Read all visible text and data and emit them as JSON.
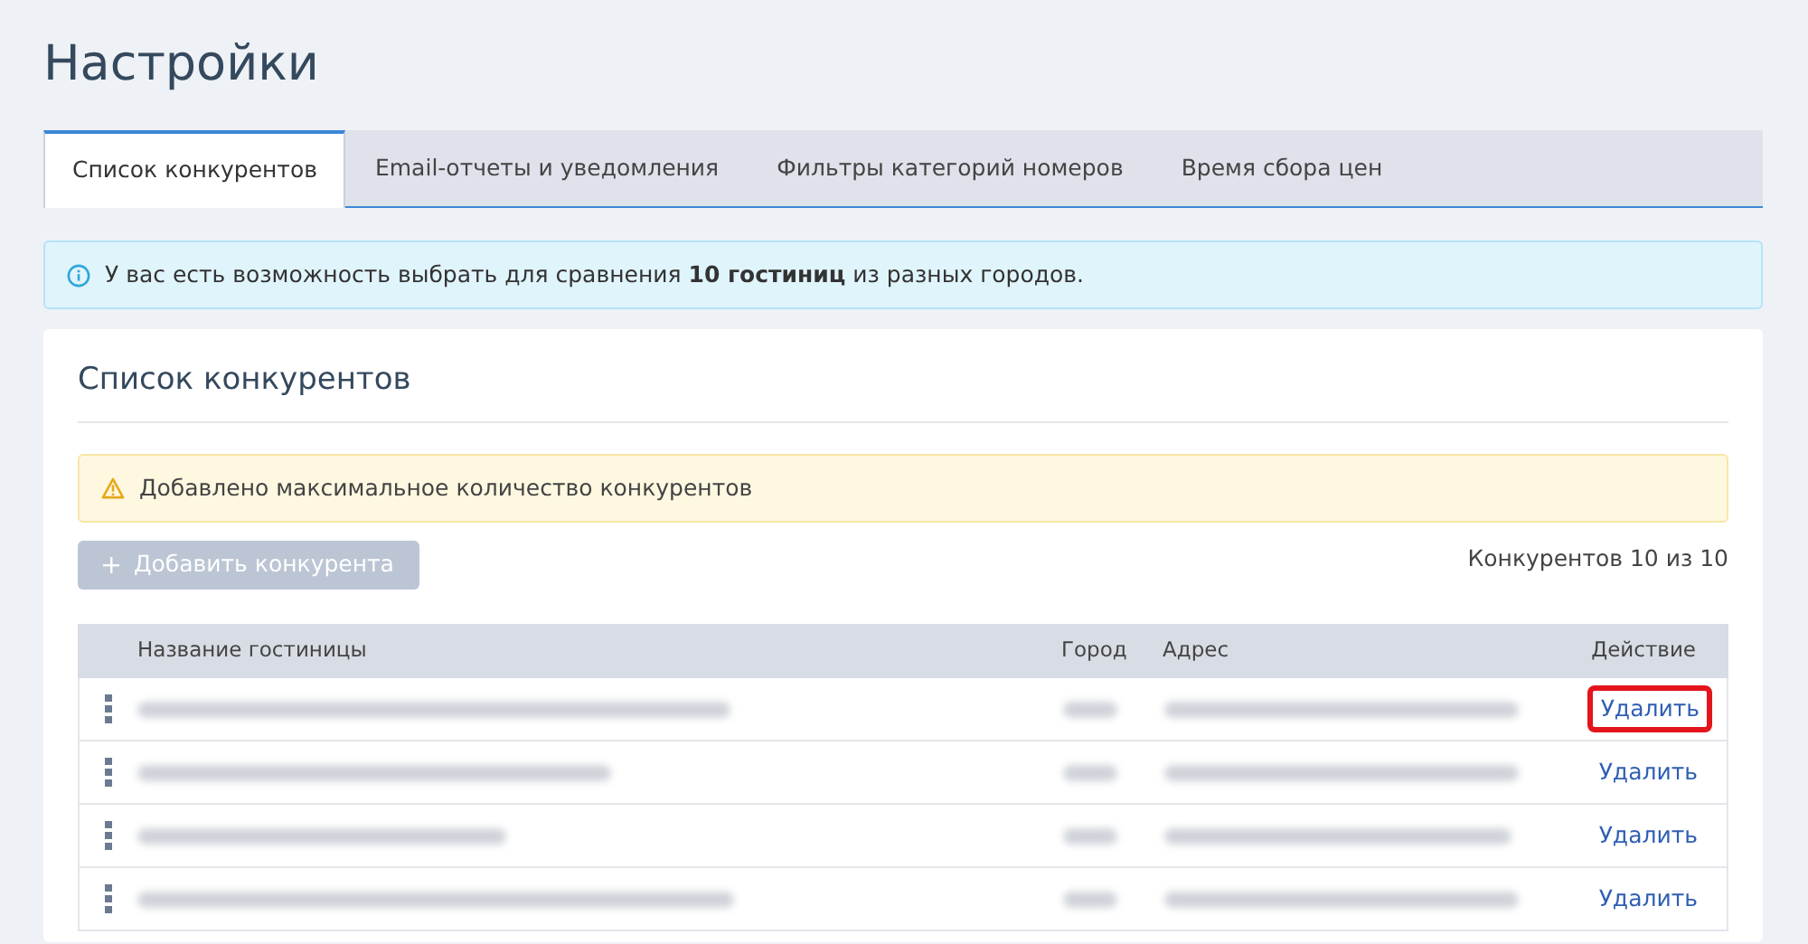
{
  "page_title": "Настройки",
  "tabs": [
    {
      "label": "Список конкурентов",
      "selected": true
    },
    {
      "label": "Email-отчеты и уведомления",
      "selected": false
    },
    {
      "label": "Фильтры категорий номеров",
      "selected": false
    },
    {
      "label": "Время сбора цен",
      "selected": false
    }
  ],
  "info_alert": "У вас есть возможность выбрать для сравнения **10 гостиниц** из разных городов.",
  "card": {
    "title": "Список конкурентов",
    "warning_alert": "Добавлено максимальное количество конкурентов",
    "add_button": {
      "label": "Добавить конкурента",
      "disabled": true
    },
    "counter": "Конкурентов 10 из 10",
    "table": {
      "columns": [
        "Название гостиницы",
        "Город",
        "Адрес",
        "Действие"
      ],
      "rows": [
        {
          "action": "Удалить",
          "highlighted": true
        },
        {
          "action": "Удалить",
          "highlighted": false
        },
        {
          "action": "Удалить",
          "highlighted": false
        },
        {
          "action": "Удалить",
          "highlighted": false
        }
      ]
    }
  }
}
